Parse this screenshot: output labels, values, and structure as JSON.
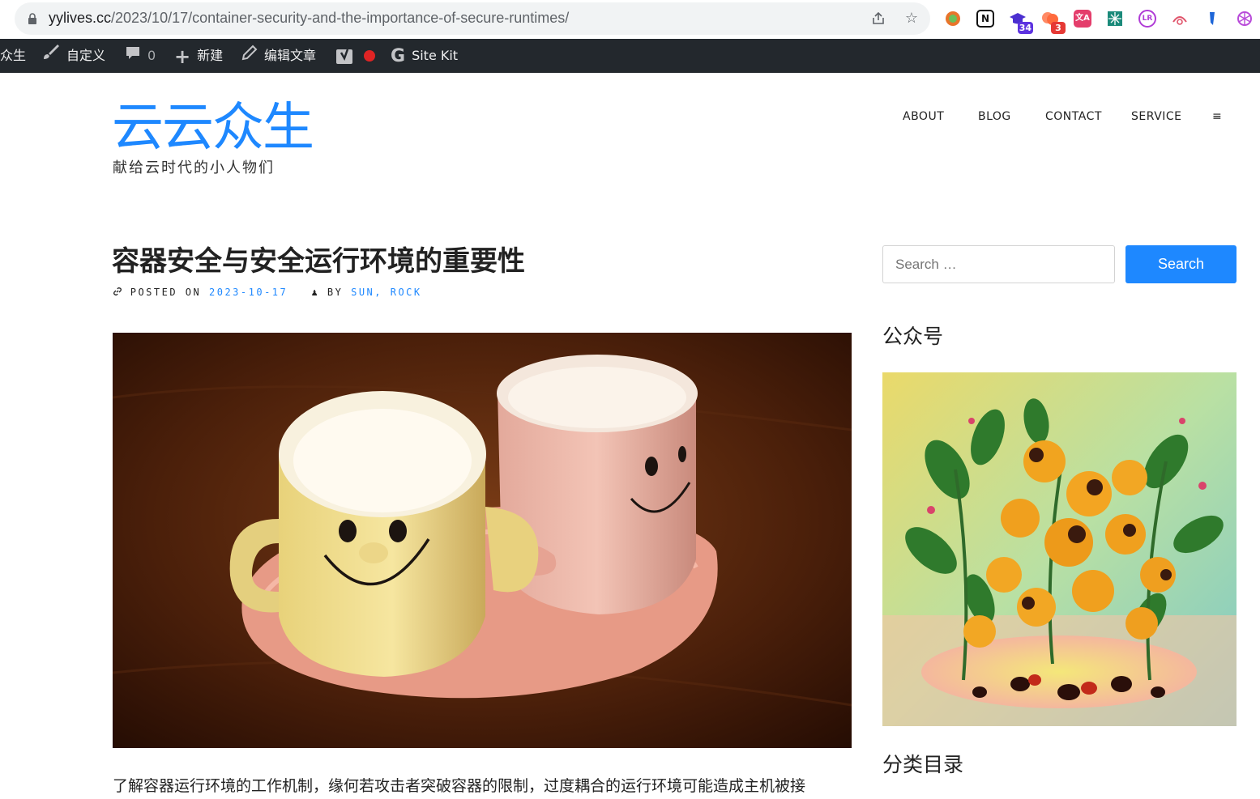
{
  "browser": {
    "url_host": "yylives.cc",
    "url_path": "/2023/10/17/container-security-and-the-importance-of-secure-runtimes/",
    "extensions": [
      {
        "name": "circle-ext-icon",
        "color": "#e8742a",
        "label": "",
        "badge": ""
      },
      {
        "name": "notion-icon",
        "color": "#111111",
        "label": "N",
        "badge": ""
      },
      {
        "name": "graduation-cap-icon",
        "color": "#4b2fd0",
        "label": "🎓",
        "badge": "34"
      },
      {
        "name": "puzzle-ext-icon",
        "color": "#ff6a3d",
        "label": "",
        "badge": "3"
      },
      {
        "name": "translate-icon",
        "color": "#e43d6b",
        "label": "文A",
        "badge": ""
      },
      {
        "name": "grid-ext-icon",
        "color": "#1a8a7a",
        "label": "",
        "badge": ""
      },
      {
        "name": "ublock-icon",
        "color": "#b03cd6",
        "label": "LR",
        "badge": ""
      },
      {
        "name": "weibo-icon",
        "color": "#e0546b",
        "label": "",
        "badge": ""
      },
      {
        "name": "bookmark-ext-icon",
        "color": "#1e66d8",
        "label": "",
        "badge": ""
      },
      {
        "name": "openai-icon",
        "color": "#b84ad9",
        "label": "",
        "badge": ""
      }
    ],
    "badge_colors": {
      "graduation": "#5d33e0",
      "puzzle": "#e53935"
    }
  },
  "adminbar": {
    "site_name": "众生",
    "customize": "自定义",
    "comments": "0",
    "new": "新建",
    "edit": "编辑文章",
    "sitekit": "Site Kit"
  },
  "site": {
    "title": "云云众生",
    "description": "献给云时代的小人物们"
  },
  "nav": {
    "about": "ABOUT",
    "blog": "BLOG",
    "contact": "CONTACT",
    "service": "SERVICE",
    "menu": "≡"
  },
  "post": {
    "title": "容器安全与安全运行环境的重要性",
    "posted_on_label": "POSTED ON",
    "date": "2023-10-17",
    "by_label": "BY",
    "author": "SUN, ROCK",
    "excerpt": "了解容器运行环境的工作机制，缘何若攻击者突破容器的限制，过度耦合的运行环境可能造成主机被接"
  },
  "sidebar": {
    "search_placeholder": "Search …",
    "search_button": "Search",
    "widget_wechat": "公众号",
    "widget_categories": "分类目录"
  },
  "colors": {
    "accent": "#1e88ff",
    "adminbar_bg": "#23282d"
  }
}
